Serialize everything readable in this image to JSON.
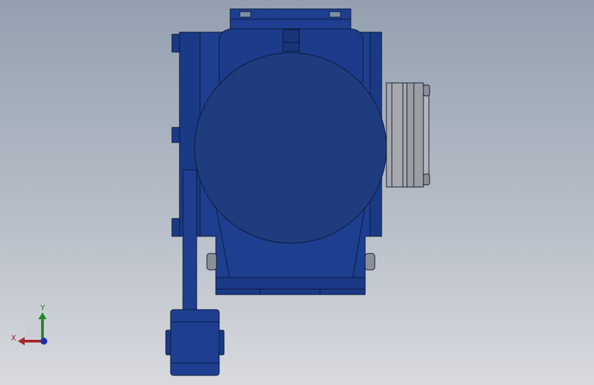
{
  "viewport": {
    "background_top": "#94a0b0",
    "background_bottom": "#d8dadf"
  },
  "model": {
    "body_color": "#1e3f8f",
    "body_shade": "#183578",
    "outline_color": "#0b1838",
    "flange_color": "#a7a9ad",
    "bolt_color": "#8c9096"
  },
  "triad": {
    "x_label": "X",
    "y_label": "Y",
    "x_color": "#a3282c",
    "y_color": "#1f8a2a",
    "z_color": "#1c2fb0"
  }
}
